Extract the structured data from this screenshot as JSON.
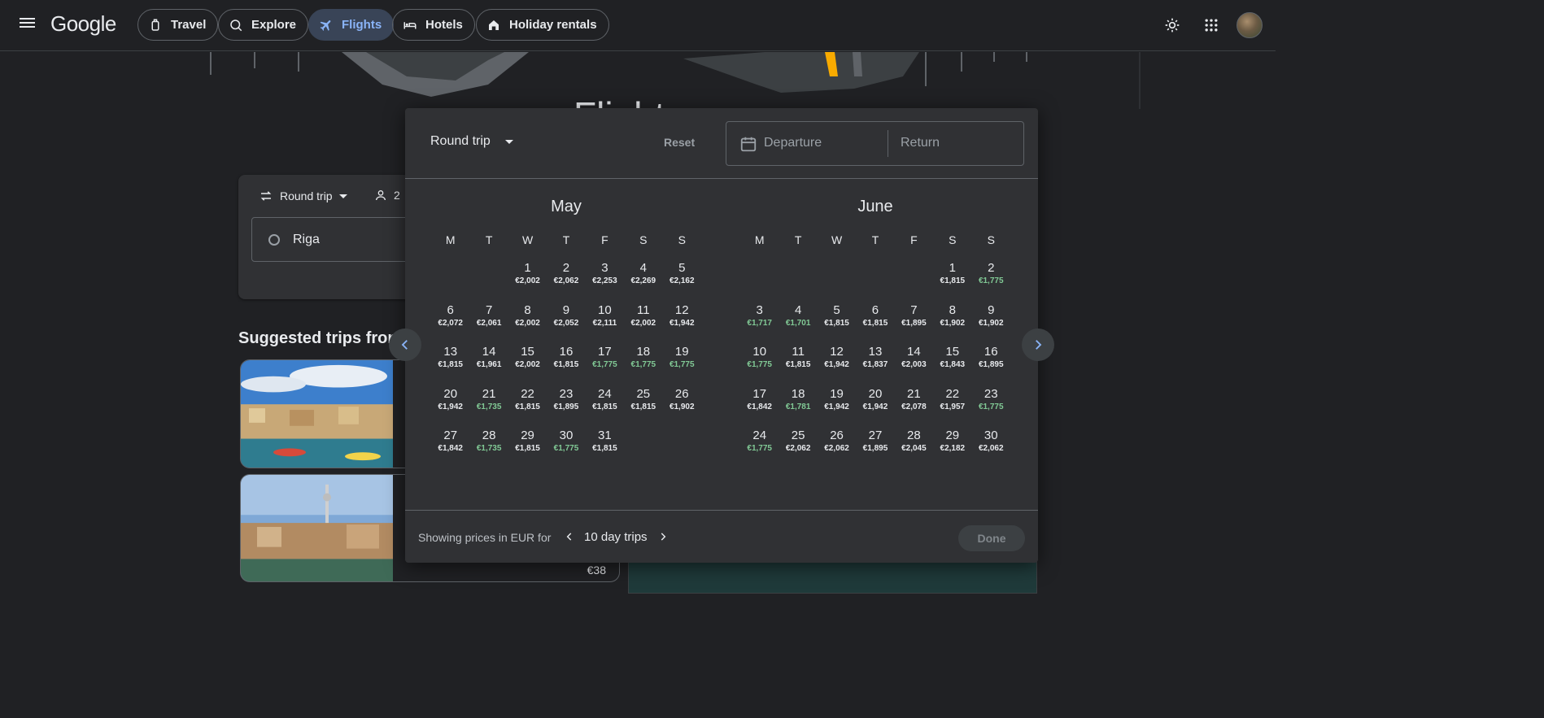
{
  "header": {
    "logo": "Google",
    "nav": [
      {
        "label": "Travel",
        "icon": "luggage-icon"
      },
      {
        "label": "Explore",
        "icon": "explore-icon"
      },
      {
        "label": "Flights",
        "icon": "plane-icon",
        "active": true
      },
      {
        "label": "Hotels",
        "icon": "bed-icon"
      },
      {
        "label": "Holiday rentals",
        "icon": "home-icon"
      }
    ]
  },
  "hero": {
    "title": "Flights"
  },
  "search": {
    "trip_type": "Round trip",
    "passengers": "2",
    "origin": "Riga"
  },
  "suggested": {
    "title": "Suggested trips from",
    "cards": [
      {
        "price": ""
      },
      {
        "price": "€38"
      }
    ]
  },
  "dialog": {
    "trip_type": "Round trip",
    "reset_label": "Reset",
    "departure_placeholder": "Departure",
    "return_placeholder": "Return",
    "months": [
      {
        "name": "May",
        "weekdays": [
          "M",
          "T",
          "W",
          "T",
          "F",
          "S",
          "S"
        ],
        "offset": 2,
        "days": [
          {
            "d": "1",
            "p": "€2,002"
          },
          {
            "d": "2",
            "p": "€2,062"
          },
          {
            "d": "3",
            "p": "€2,253"
          },
          {
            "d": "4",
            "p": "€2,269"
          },
          {
            "d": "5",
            "p": "€2,162"
          },
          {
            "d": "6",
            "p": "€2,072"
          },
          {
            "d": "7",
            "p": "€2,061"
          },
          {
            "d": "8",
            "p": "€2,002"
          },
          {
            "d": "9",
            "p": "€2,052"
          },
          {
            "d": "10",
            "p": "€2,111"
          },
          {
            "d": "11",
            "p": "€2,002"
          },
          {
            "d": "12",
            "p": "€1,942"
          },
          {
            "d": "13",
            "p": "€1,815"
          },
          {
            "d": "14",
            "p": "€1,961"
          },
          {
            "d": "15",
            "p": "€2,002"
          },
          {
            "d": "16",
            "p": "€1,815"
          },
          {
            "d": "17",
            "p": "€1,775",
            "low": true
          },
          {
            "d": "18",
            "p": "€1,775",
            "low": true
          },
          {
            "d": "19",
            "p": "€1,775",
            "low": true
          },
          {
            "d": "20",
            "p": "€1,942"
          },
          {
            "d": "21",
            "p": "€1,735",
            "low": true
          },
          {
            "d": "22",
            "p": "€1,815"
          },
          {
            "d": "23",
            "p": "€1,895"
          },
          {
            "d": "24",
            "p": "€1,815"
          },
          {
            "d": "25",
            "p": "€1,815"
          },
          {
            "d": "26",
            "p": "€1,902"
          },
          {
            "d": "27",
            "p": "€1,842"
          },
          {
            "d": "28",
            "p": "€1,735",
            "low": true
          },
          {
            "d": "29",
            "p": "€1,815"
          },
          {
            "d": "30",
            "p": "€1,775",
            "low": true
          },
          {
            "d": "31",
            "p": "€1,815"
          }
        ]
      },
      {
        "name": "June",
        "weekdays": [
          "M",
          "T",
          "W",
          "T",
          "F",
          "S",
          "S"
        ],
        "offset": 5,
        "days": [
          {
            "d": "1",
            "p": "€1,815"
          },
          {
            "d": "2",
            "p": "€1,775",
            "low": true
          },
          {
            "d": "3",
            "p": "€1,717",
            "low": true
          },
          {
            "d": "4",
            "p": "€1,701",
            "low": true
          },
          {
            "d": "5",
            "p": "€1,815"
          },
          {
            "d": "6",
            "p": "€1,815"
          },
          {
            "d": "7",
            "p": "€1,895"
          },
          {
            "d": "8",
            "p": "€1,902"
          },
          {
            "d": "9",
            "p": "€1,902"
          },
          {
            "d": "10",
            "p": "€1,775",
            "low": true
          },
          {
            "d": "11",
            "p": "€1,815"
          },
          {
            "d": "12",
            "p": "€1,942"
          },
          {
            "d": "13",
            "p": "€1,837"
          },
          {
            "d": "14",
            "p": "€2,003"
          },
          {
            "d": "15",
            "p": "€1,843"
          },
          {
            "d": "16",
            "p": "€1,895"
          },
          {
            "d": "17",
            "p": "€1,842"
          },
          {
            "d": "18",
            "p": "€1,781",
            "low": true
          },
          {
            "d": "19",
            "p": "€1,942"
          },
          {
            "d": "20",
            "p": "€1,942"
          },
          {
            "d": "21",
            "p": "€2,078"
          },
          {
            "d": "22",
            "p": "€1,957"
          },
          {
            "d": "23",
            "p": "€1,775",
            "low": true
          },
          {
            "d": "24",
            "p": "€1,775",
            "low": true
          },
          {
            "d": "25",
            "p": "€2,062"
          },
          {
            "d": "26",
            "p": "€2,062"
          },
          {
            "d": "27",
            "p": "€1,895"
          },
          {
            "d": "28",
            "p": "€2,045"
          },
          {
            "d": "29",
            "p": "€2,182"
          },
          {
            "d": "30",
            "p": "€2,062"
          }
        ]
      }
    ],
    "footer": {
      "showing_text": "Showing prices in EUR for",
      "trip_length": "10 day trips",
      "done_label": "Done"
    }
  },
  "colors": {
    "background": "#202124",
    "surface": "#303134",
    "accent": "#8ab4f8",
    "low_price": "#81c995"
  }
}
